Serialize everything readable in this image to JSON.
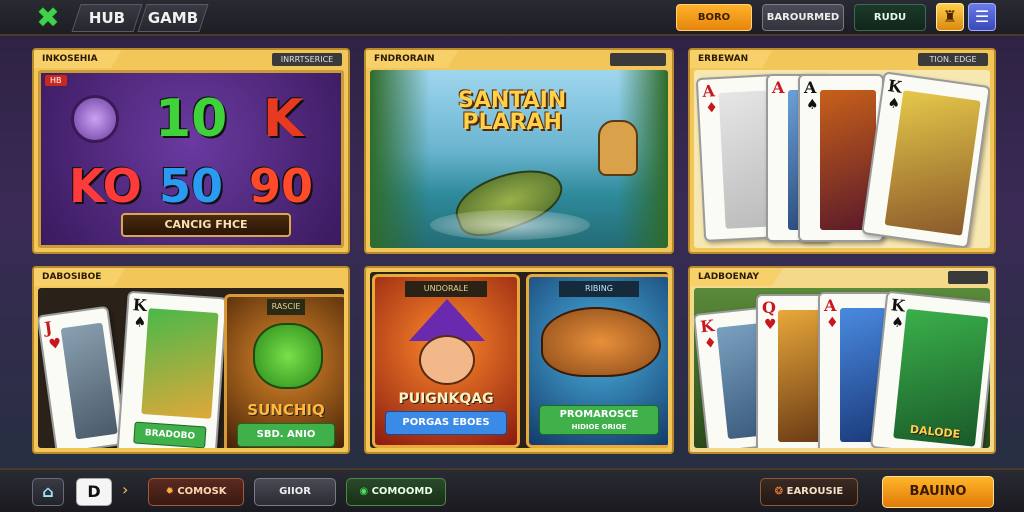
{
  "header": {
    "logo_icon": "x-logo-icon",
    "tab1": "HUB",
    "tab2": "GAMB",
    "btn_orange": "BORO",
    "btn_grey": "BAROURMED",
    "btn_green": "RUDU",
    "icon_trophy": "trophy-icon",
    "icon_menu": "menu-icon"
  },
  "panels": {
    "slots": {
      "tag": "INKOSEHIA",
      "tag_right": "INRRTSERICE",
      "tile_label": "HB",
      "symbols": [
        "10",
        "K",
        "KO",
        "90",
        "50"
      ],
      "plate": "CANCIG FHCE"
    },
    "fishing": {
      "tag": "FNDRORAIN",
      "tag_right": "",
      "title_line1": "SANTAIN",
      "title_line2": "PLARAH"
    },
    "cards_top": {
      "tag": "ERBEWAN",
      "tag_right": "TION. EDGE",
      "cards": [
        {
          "rank": "A",
          "suit": "♦"
        },
        {
          "rank": "A",
          "suit": "♠"
        },
        {
          "rank": "K",
          "suit": "♠"
        },
        {
          "rank": "K",
          "suit": "♥"
        }
      ]
    },
    "cards_left": {
      "tag": "DABOSIBOE",
      "cards": [
        {
          "rank": "J",
          "suit": "♥"
        },
        {
          "rank": "K",
          "suit": "♠"
        }
      ],
      "card_btn": "BRADOBO",
      "game_label": "RASCIE",
      "game_title": "SUNCHIQ",
      "game_btn": "SBD. ANIO"
    },
    "middle": {
      "tag": "",
      "card1_label": "UNDORALE",
      "card1_title": "PUIGNKQAG",
      "card1_btn": "PORGAS EBOES",
      "card2_label": "RIBING",
      "card2_title": "PROMAROSCE",
      "card2_btn": "HIDIOE ORIOE"
    },
    "cards_right": {
      "tag": "LADBOENAY",
      "tag_right": "",
      "cards": [
        {
          "rank": "K",
          "suit": "♦"
        },
        {
          "rank": "Q",
          "suit": "♥"
        },
        {
          "rank": "A",
          "suit": "♦"
        },
        {
          "rank": "K",
          "suit": "♠"
        }
      ],
      "card_caption": "DALODE"
    }
  },
  "footer": {
    "home_icon": "home-icon",
    "d_icon": "d-logo-icon",
    "chevron": "›",
    "btn1": "COMOSK",
    "btn2": "GIIOR",
    "btn3": "COMOOMD",
    "btn4": "EAROUSIE",
    "btn_play": "BAUINO"
  }
}
